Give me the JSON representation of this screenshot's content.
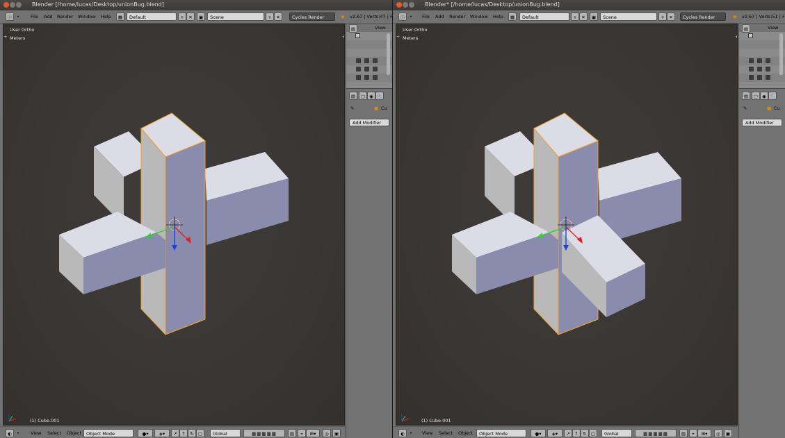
{
  "windows": [
    {
      "title": "Blender [/home/lucas/Desktop/unionBug.blend]",
      "menus": [
        "File",
        "Add",
        "Render",
        "Window",
        "Help"
      ],
      "layout": "Default",
      "scene": "Scene",
      "render_engine": "Cycles Render",
      "stats": "v2.67 | Verts:47 | Fa",
      "view_name": "User Ortho",
      "units": "Meters",
      "object_info": "(1) Cube.001",
      "bottom": {
        "view": "View",
        "select": "Select",
        "object": "Object",
        "mode": "Object Mode",
        "orientation": "Global"
      },
      "panel": {
        "view": "View",
        "object": "Cu",
        "add_modifier": "Add Modifier"
      }
    },
    {
      "title": "Blender* [/home/lucas/Desktop/unionBug.blend]",
      "menus": [
        "File",
        "Add",
        "Render",
        "Window",
        "Help"
      ],
      "layout": "Default",
      "scene": "Scene",
      "render_engine": "Cycles Render",
      "stats": "v2.67 | Verts:51 | F",
      "view_name": "User Ortho",
      "units": "Meters",
      "object_info": "(1) Cube.001",
      "bottom": {
        "view": "View",
        "select": "Select",
        "object": "Object",
        "mode": "Object Mode",
        "orientation": "Global"
      },
      "panel": {
        "view": "View",
        "object": "Cu",
        "add_modifier": "Add Modifier"
      }
    }
  ],
  "colors": {
    "selection_outline": "#f0a030",
    "face_top": "#dcdce6",
    "face_front": "#8a8cae",
    "face_side": "#b9b9b9",
    "accent_close": "#e35a29"
  },
  "icons": [
    "window-close-icon",
    "window-minimize-icon",
    "window-maximize-icon",
    "editor-type-icon",
    "blender-logo-icon",
    "3d-cursor-icon",
    "axis-gizmo-icon"
  ]
}
